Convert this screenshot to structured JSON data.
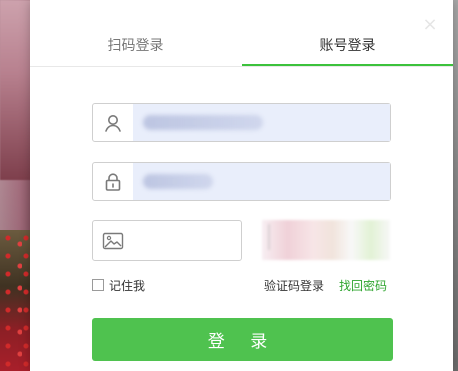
{
  "dialog": {
    "close_glyph": "×",
    "tabs": [
      {
        "label": "扫码登录"
      },
      {
        "label": "账号登录"
      }
    ],
    "remember_label": "记住我",
    "links": {
      "sms_login": "验证码登录",
      "recover": "找回密码"
    },
    "login_button": "登 录"
  },
  "colors": {
    "accent_green": "#4fc24f",
    "link_green": "#2fa52f"
  },
  "icons": {
    "username": "user-icon",
    "password": "lock-icon",
    "captcha": "image-icon",
    "close": "close-icon"
  }
}
